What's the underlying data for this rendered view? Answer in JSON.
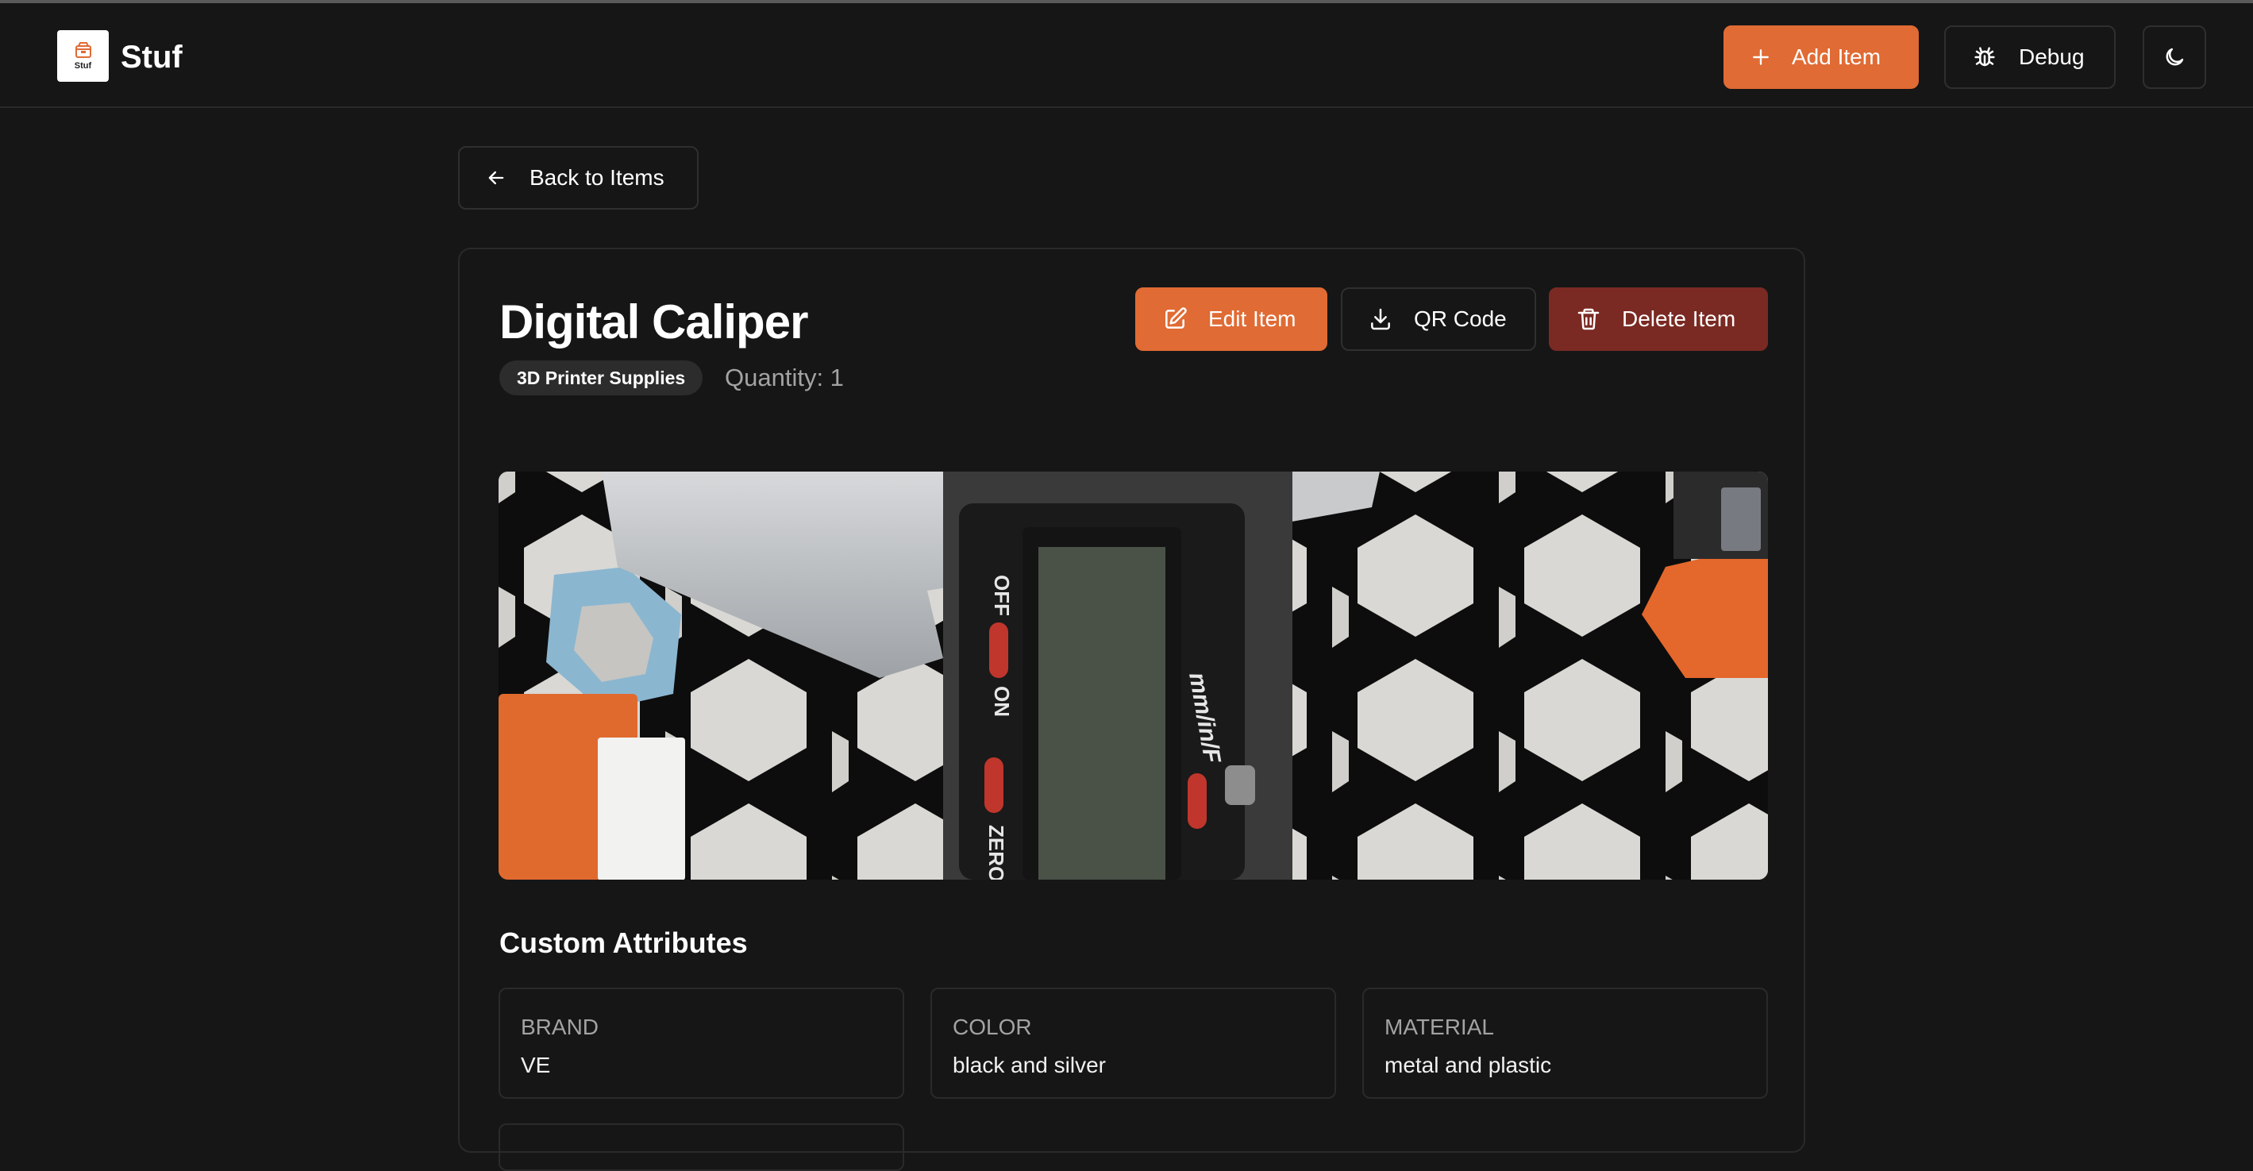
{
  "app": {
    "name": "Stuf",
    "logo_text": "Stuf"
  },
  "header": {
    "add_label": "Add Item",
    "debug_label": "Debug"
  },
  "nav": {
    "back_label": "Back to Items"
  },
  "item": {
    "title": "Digital Caliper",
    "category": "3D Printer Supplies",
    "quantity_text": "Quantity: 1",
    "actions": {
      "edit_label": "Edit Item",
      "qr_label": "QR Code",
      "delete_label": "Delete Item"
    }
  },
  "attributes": {
    "title": "Custom Attributes",
    "items": [
      {
        "key": "BRAND",
        "value": "VE"
      },
      {
        "key": "COLOR",
        "value": "black and silver"
      },
      {
        "key": "MATERIAL",
        "value": "metal and plastic"
      }
    ]
  },
  "colors": {
    "accent": "#e06b34",
    "danger": "#7a2a23",
    "background": "#161616",
    "border": "#2a2a2a"
  },
  "icons": {
    "add": "plus-icon",
    "debug": "bug-icon",
    "theme": "moon-icon",
    "back": "arrow-left-icon",
    "edit": "edit-icon",
    "qr": "download-icon",
    "delete": "trash-icon"
  }
}
